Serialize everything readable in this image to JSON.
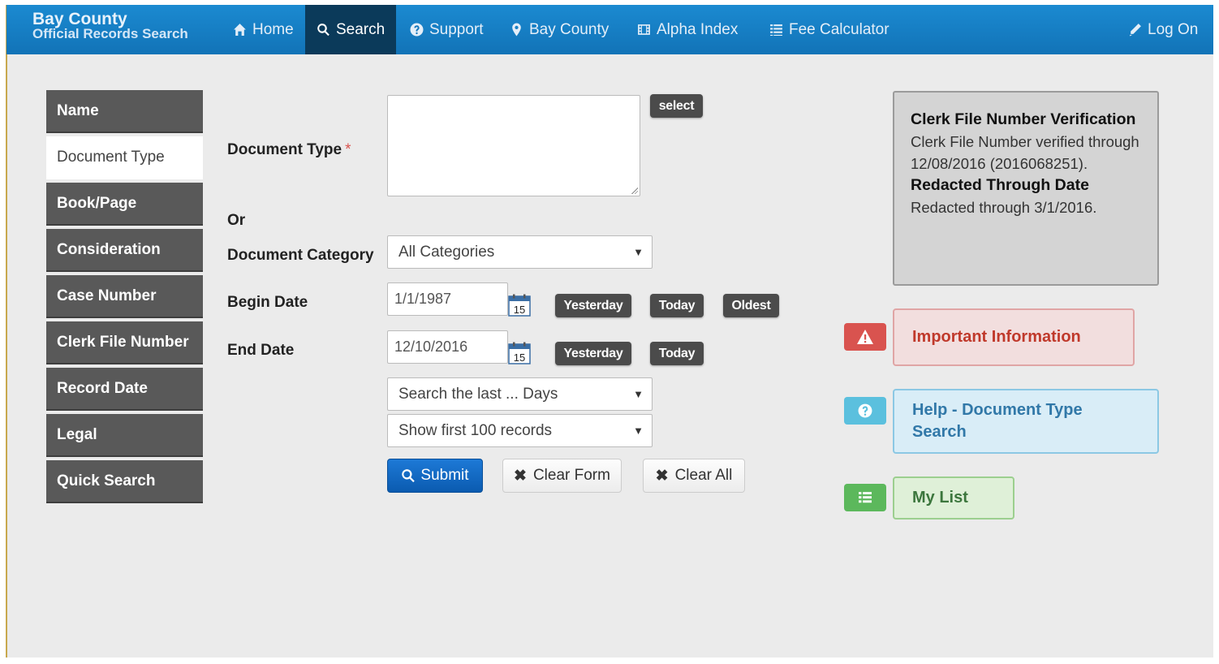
{
  "brand": {
    "line1": "Bay County",
    "line2": "Official Records Search"
  },
  "nav": {
    "home": "Home",
    "search": "Search",
    "support": "Support",
    "bay_county": "Bay County",
    "alpha_index": "Alpha Index",
    "fee_calculator": "Fee Calculator",
    "log_on": "Log On"
  },
  "sidebar": {
    "items": [
      {
        "label": "Name"
      },
      {
        "label": "Document Type",
        "active": true
      },
      {
        "label": "Book/Page"
      },
      {
        "label": "Consideration"
      },
      {
        "label": "Case Number"
      },
      {
        "label": "Clerk File Number"
      },
      {
        "label": "Record Date"
      },
      {
        "label": "Legal"
      },
      {
        "label": "Quick Search"
      }
    ]
  },
  "form": {
    "document_type_label": "Document Type",
    "required_marker": "*",
    "document_type_value": "",
    "select_button": "select",
    "or_label": "Or",
    "document_category_label": "Document Category",
    "document_category_value": "All Categories",
    "begin_date_label": "Begin Date",
    "begin_date_value": "1/1/1987",
    "end_date_label": "End Date",
    "end_date_value": "12/10/2016",
    "calendar_day": "15",
    "yesterday": "Yesterday",
    "today": "Today",
    "oldest": "Oldest",
    "search_last_days": "Search the last ... Days",
    "show_first_records": "Show first 100 records",
    "submit": "Submit",
    "clear_form": "Clear Form",
    "clear_all": "Clear All"
  },
  "info": {
    "heading1": "Clerk File Number Verification",
    "text1": "Clerk File Number verified through 12/08/2016 (2016068251).",
    "heading2": "Redacted Through Date",
    "text2": "Redacted through 3/1/2016."
  },
  "panels": {
    "important": "Important Information",
    "help": "Help - Document Type Search",
    "my_list": "My List"
  },
  "colors": {
    "nav": "#1a80c6",
    "nav_active": "#0b3a5a",
    "sidebar": "#595959",
    "danger": "#d9534f",
    "info": "#5bc0de",
    "success": "#5cb85c"
  }
}
